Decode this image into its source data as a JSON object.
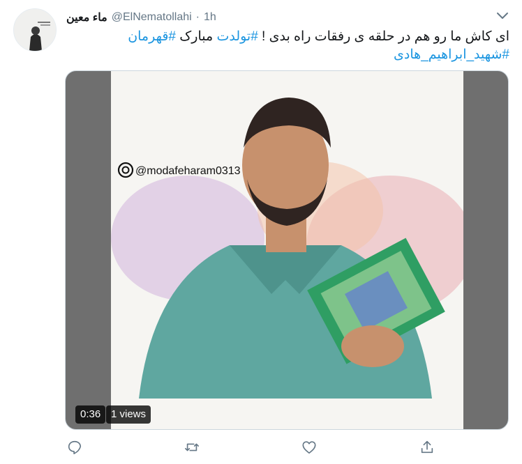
{
  "tweet": {
    "display_name": "ماء معین",
    "handle": "@ElNematollahi",
    "separator": "·",
    "time": "1h",
    "text_lines": [
      {
        "pre": "ای کاش ما رو هم در حلقه ی رفقات راه بدی ! ",
        "tag1": "#تولدت",
        "mid": " مبارک ",
        "tag2": "#قهرمان"
      },
      {
        "tag": "#شهید_ابراهیم_هادی"
      }
    ]
  },
  "media": {
    "watermark": "@modafeharam0313",
    "duration": "0:36",
    "views": "1 views"
  },
  "actions": [
    "reply-icon",
    "retweet-icon",
    "like-icon",
    "share-icon"
  ]
}
